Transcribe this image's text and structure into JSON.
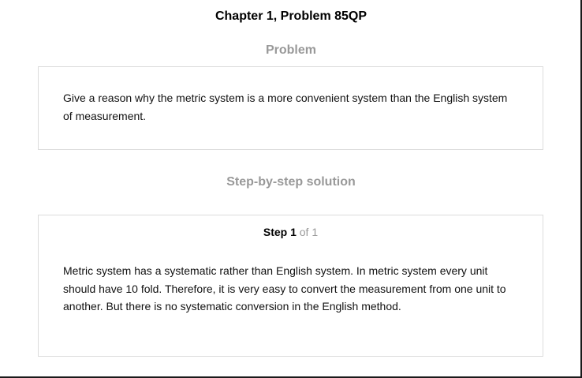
{
  "page": {
    "title": "Chapter 1, Problem 85QP"
  },
  "problem": {
    "heading": "Problem",
    "text": "Give a reason why the metric system is a more convenient system than the English system of measurement."
  },
  "solution": {
    "heading": "Step-by-step solution",
    "step_label": "Step 1",
    "step_of": "of 1",
    "text": "Metric system has a systematic rather than English system. In metric system every unit should have 10 fold. Therefore, it is very easy to convert the measurement from one unit to another. But there is no systematic conversion in the English method."
  },
  "colors": {
    "heading_gray": "#999999",
    "card_border": "#dcdcdc",
    "text": "#111111"
  }
}
